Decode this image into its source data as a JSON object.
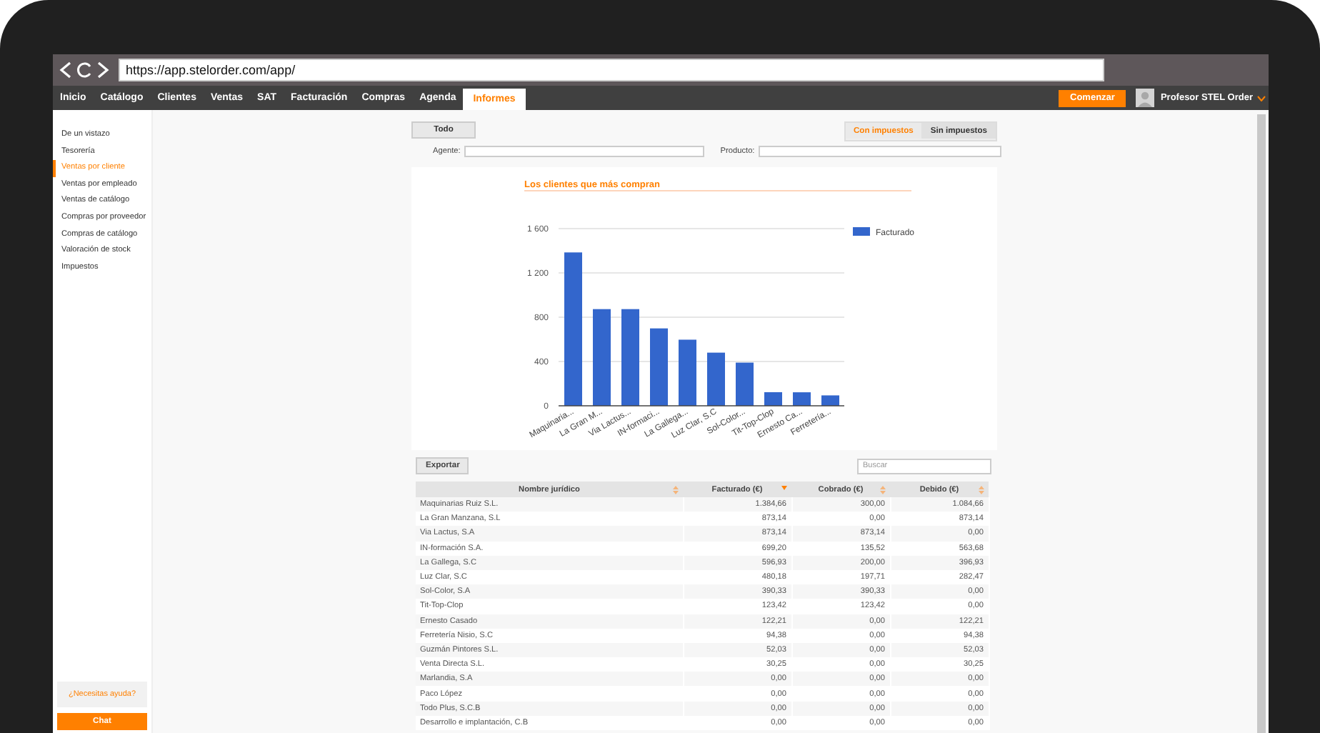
{
  "browser": {
    "url": "https://app.stelorder.com/app/"
  },
  "nav": {
    "tabs": [
      {
        "label": "Inicio",
        "selected": false
      },
      {
        "label": "Catálogo",
        "selected": false
      },
      {
        "label": "Clientes",
        "selected": false
      },
      {
        "label": "Ventas",
        "selected": false
      },
      {
        "label": "SAT",
        "selected": false
      },
      {
        "label": "Facturación",
        "selected": false
      },
      {
        "label": "Compras",
        "selected": false
      },
      {
        "label": "Agenda",
        "selected": false
      },
      {
        "label": "Informes",
        "selected": true
      }
    ],
    "start_button": "Comenzar",
    "user": "Profesor STEL Order"
  },
  "sidebar": {
    "items": [
      {
        "label": "De un vistazo",
        "selected": false
      },
      {
        "label": "Tesorería",
        "selected": false
      },
      {
        "label": "Ventas por cliente",
        "selected": true
      },
      {
        "label": "Ventas por empleado",
        "selected": false
      },
      {
        "label": "Ventas de catálogo",
        "selected": false
      },
      {
        "label": "Compras por proveedor",
        "selected": false
      },
      {
        "label": "Compras de catálogo",
        "selected": false
      },
      {
        "label": "Valoración de stock",
        "selected": false
      },
      {
        "label": "Impuestos",
        "selected": false
      }
    ],
    "help": "¿Necesitas ayuda?",
    "chat_button": "Chat"
  },
  "toolbar": {
    "period_button": "Todo",
    "tax_toggle": [
      {
        "label": "Con impuestos",
        "selected": true
      },
      {
        "label": "Sin impuestos",
        "selected": false
      }
    ],
    "agent_label": "Agente:",
    "product_label": "Producto:"
  },
  "chart": {
    "title": "Los clientes que más compran",
    "chart_data": {
      "type": "bar",
      "categories": [
        "Maquinaria...",
        "La Gran M...",
        "Via Lactus...",
        "IN-formaci...",
        "La Gallega...",
        "Luz Clar, S.C",
        "Sol-Color...",
        "Tit-Top-Clop",
        "Ernesto Ca...",
        "Ferretería..."
      ],
      "series": [
        {
          "name": "Facturado",
          "color": "#3366cc",
          "values": [
            1385,
            873,
            873,
            699,
            597,
            480,
            390,
            123,
            122,
            94
          ]
        }
      ],
      "grid": true,
      "ylim": [
        0,
        1600
      ],
      "yticks": [
        {
          "value": 0,
          "label": "0"
        },
        {
          "value": 400,
          "label": "400"
        },
        {
          "value": 800,
          "label": "800"
        },
        {
          "value": 1200,
          "label": "1 200"
        },
        {
          "value": 1600,
          "label": "1 600"
        }
      ]
    }
  },
  "table": {
    "export_button": "Exportar",
    "search": {
      "placeholder": "Buscar"
    },
    "columns": [
      {
        "label": "Nombre jurídico",
        "sorted": false
      },
      {
        "label": "Facturado (€)",
        "sorted": true
      },
      {
        "label": "Cobrado (€)",
        "sorted": false
      },
      {
        "label": "Debido (€)",
        "sorted": false
      }
    ],
    "rows": [
      [
        "Maquinarias Ruiz S.L.",
        "1.384,66",
        "300,00",
        "1.084,66"
      ],
      [
        "La Gran Manzana, S.L",
        "873,14",
        "0,00",
        "873,14"
      ],
      [
        "Via Lactus, S.A",
        "873,14",
        "873,14",
        "0,00"
      ],
      [
        "IN-formación S.A.",
        "699,20",
        "135,52",
        "563,68"
      ],
      [
        "La Gallega, S.C",
        "596,93",
        "200,00",
        "396,93"
      ],
      [
        "Luz Clar, S.C",
        "480,18",
        "197,71",
        "282,47"
      ],
      [
        "Sol-Color, S.A",
        "390,33",
        "390,33",
        "0,00"
      ],
      [
        "Tit-Top-Clop",
        "123,42",
        "123,42",
        "0,00"
      ],
      [
        "Ernesto Casado",
        "122,21",
        "0,00",
        "122,21"
      ],
      [
        "Ferretería Nisio, S.C",
        "94,38",
        "0,00",
        "94,38"
      ],
      [
        "Guzmán Pintores S.L.",
        "52,03",
        "0,00",
        "52,03"
      ],
      [
        "Venta Directa S.L.",
        "30,25",
        "0,00",
        "30,25"
      ],
      [
        "Marlandia, S.A",
        "0,00",
        "0,00",
        "0,00"
      ],
      [
        "Paco López",
        "0,00",
        "0,00",
        "0,00"
      ],
      [
        "Todo Plus, S.C.B",
        "0,00",
        "0,00",
        "0,00"
      ],
      [
        "Desarrollo e implantación, C.B",
        "0,00",
        "0,00",
        "0,00"
      ]
    ]
  }
}
